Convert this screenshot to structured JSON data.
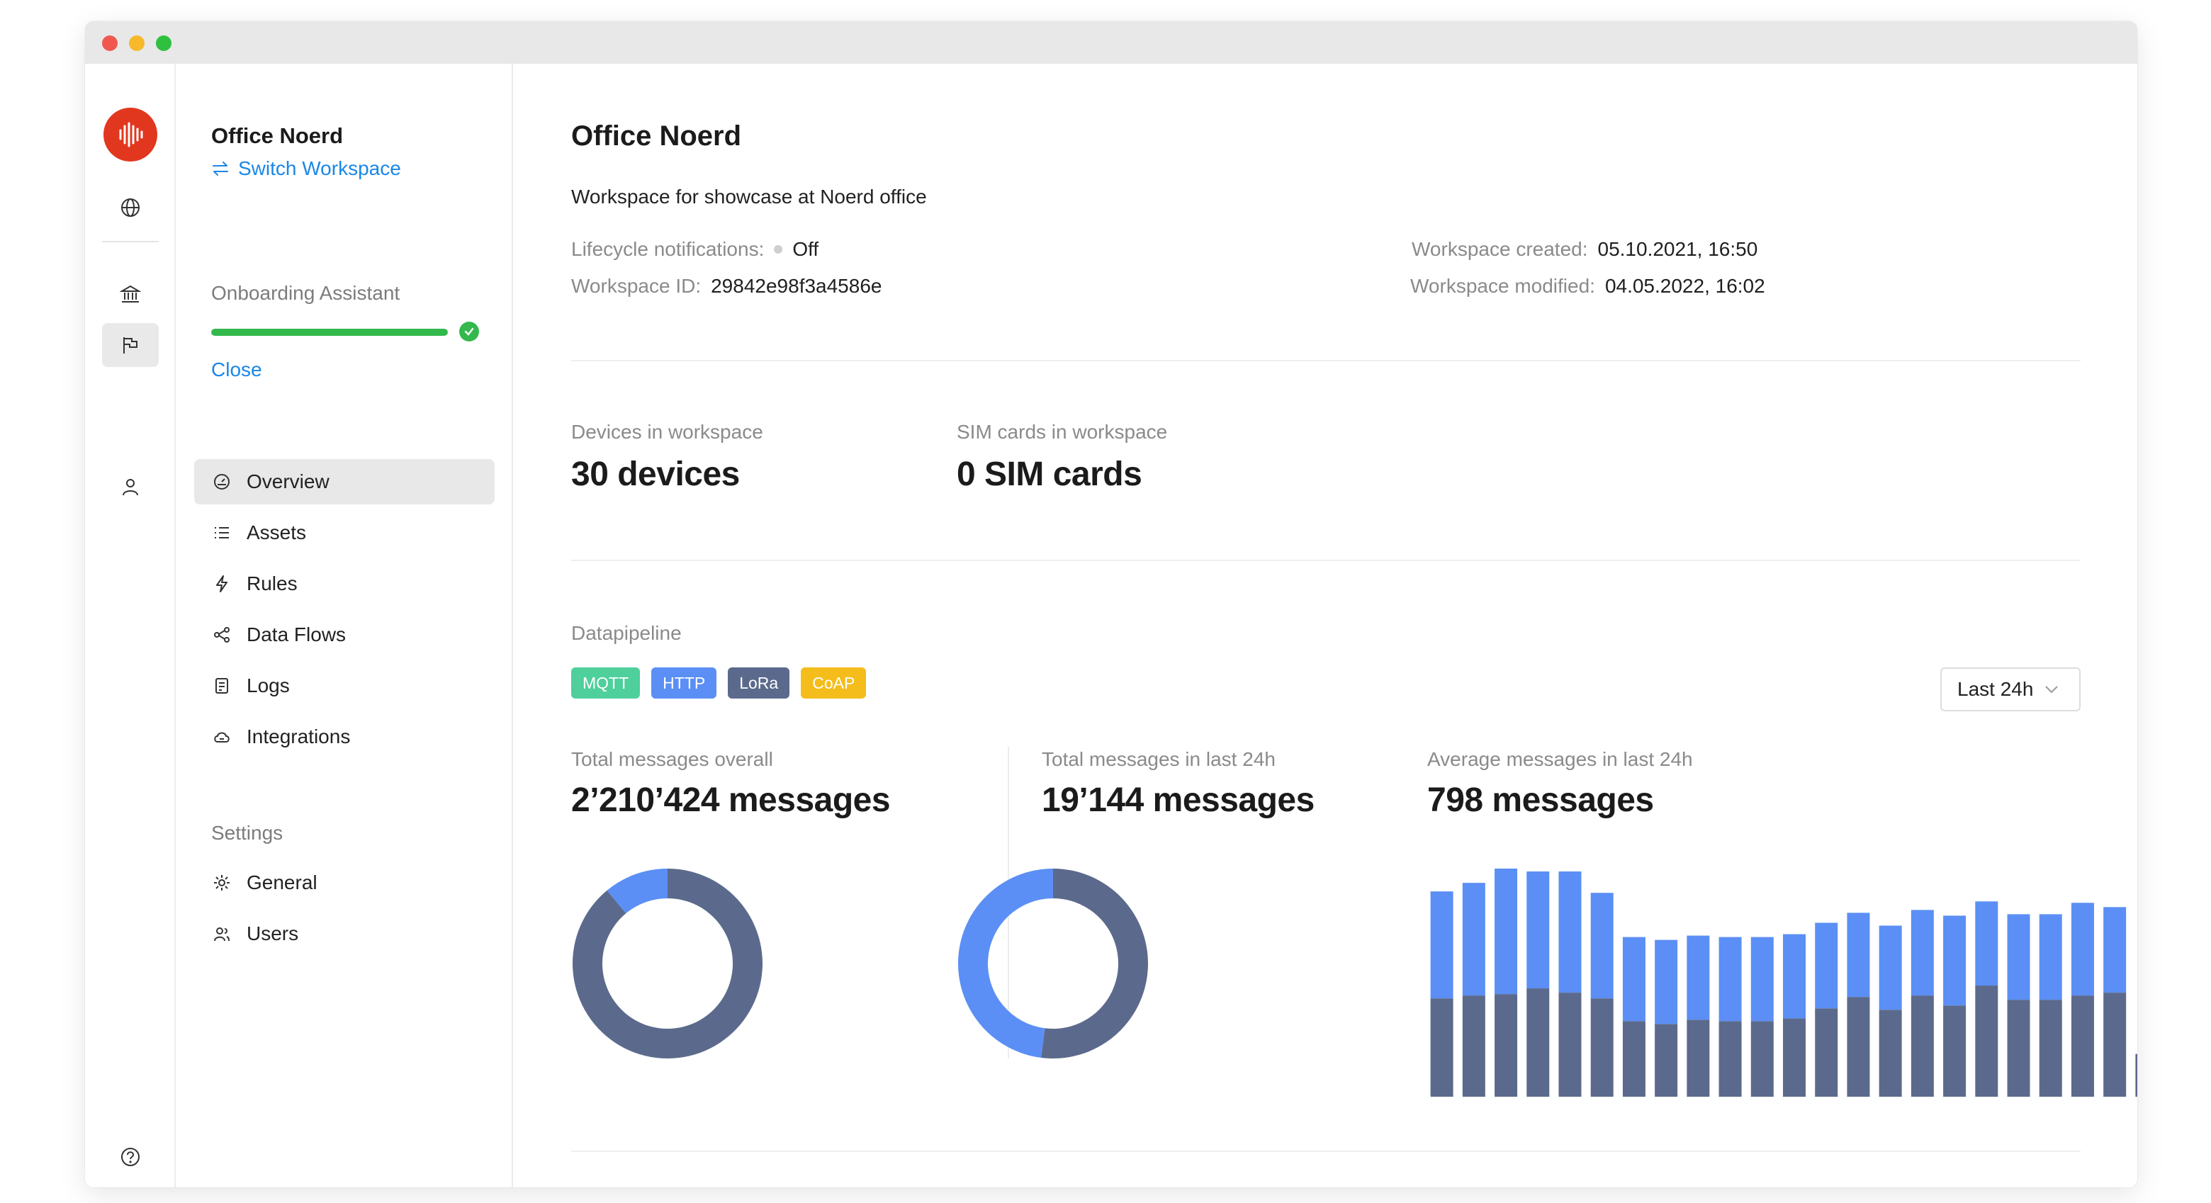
{
  "sidebar": {
    "workspace_name": "Office Noerd",
    "switch_workspace": "Switch Workspace",
    "onboarding": {
      "title": "Onboarding Assistant",
      "progress": 1.0,
      "close": "Close"
    },
    "nav_items": [
      {
        "label": "Overview",
        "icon": "dashboard-icon",
        "active": true
      },
      {
        "label": "Assets",
        "icon": "list-icon"
      },
      {
        "label": "Rules",
        "icon": "lightning-icon"
      },
      {
        "label": "Data Flows",
        "icon": "share-icon"
      },
      {
        "label": "Logs",
        "icon": "log-icon"
      },
      {
        "label": "Integrations",
        "icon": "cloud-sync-icon"
      }
    ],
    "settings_title": "Settings",
    "settings_items": [
      {
        "label": "General",
        "icon": "gear-icon"
      },
      {
        "label": "Users",
        "icon": "users-icon"
      }
    ]
  },
  "main": {
    "title": "Office Noerd",
    "description": "Workspace for showcase at Noerd office",
    "lifecycle": {
      "label": "Lifecycle notifications",
      "value": "Off"
    },
    "workspace_id": {
      "label": "Workspace ID",
      "value": "29842e98f3a4586e"
    },
    "created": {
      "label": "Workspace created",
      "value": "05.10.2021, 16:50"
    },
    "modified": {
      "label": "Workspace modified",
      "value": "04.05.2022, 16:02"
    },
    "devices": {
      "label": "Devices in workspace",
      "value": "30 devices"
    },
    "sims": {
      "label": "SIM cards in workspace",
      "value": "0 SIM cards"
    },
    "datapipeline": {
      "title": "Datapipeline",
      "protocols": [
        {
          "label": "MQTT",
          "color": "#4fcf9b"
        },
        {
          "label": "HTTP",
          "color": "#5b8ff5"
        },
        {
          "label": "LoRa",
          "color": "#5b6a8c"
        },
        {
          "label": "CoAP",
          "color": "#f4bd1c"
        }
      ],
      "range": "Last 24h",
      "total_overall": {
        "label": "Total messages overall",
        "value": "2’210’424 messages"
      },
      "total_24h": {
        "label": "Total messages in last 24h",
        "value": "19’144 messages"
      },
      "avg_24h": {
        "label": "Average messages in last 24h",
        "value": "798 messages"
      }
    }
  },
  "chart_data": [
    {
      "type": "pie",
      "values": [
        89,
        11
      ],
      "colors": [
        "#5b6a8c",
        "#5b8ff5"
      ]
    },
    {
      "type": "pie",
      "values": [
        52,
        48
      ],
      "colors": [
        "#5b6a8c",
        "#5b8ff5"
      ]
    },
    {
      "type": "bar",
      "stacked": true,
      "colors": [
        "#5b6a8c",
        "#5b8ff5"
      ],
      "series": [
        {
          "values": [
            69,
            71,
            72,
            76,
            73,
            69,
            53,
            51,
            54,
            53,
            53,
            55,
            62,
            70,
            61,
            71,
            64,
            78,
            68,
            68,
            71,
            73,
            30
          ]
        },
        {
          "values": [
            75,
            79,
            88,
            82,
            85,
            74,
            59,
            59,
            59,
            59,
            59,
            59,
            60,
            59,
            59,
            60,
            63,
            59,
            60,
            60,
            65,
            60,
            0
          ]
        }
      ]
    }
  ]
}
